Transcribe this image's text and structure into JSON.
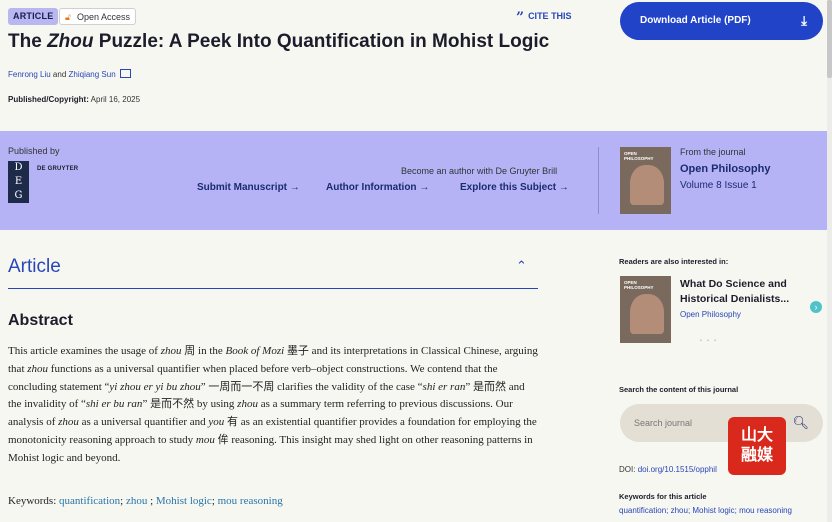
{
  "header": {
    "badge_article": "ARTICLE",
    "badge_open_access": "Open Access",
    "cite": "CITE THIS",
    "download": "Download Article (PDF)",
    "title_pre": "The ",
    "title_em": "Zhou",
    "title_post": " Puzzle: A Peek Into Quantification in Mohist Logic",
    "author1": "Fenrong Liu",
    "author_and": " and ",
    "author2": "Zhiqiang Sun",
    "pub_label": "Published/Copyright:",
    "pub_date": "April 16, 2025"
  },
  "band": {
    "published_by": "Published by",
    "publisher": "DE GRUYTER",
    "become_author": "Become an author with De Gruyter Brill",
    "links": [
      "Submit Manuscript",
      "Author Information",
      "Explore this Subject"
    ],
    "arrow": "→",
    "from_journal": "From the journal",
    "journal_name": "Open Philosophy",
    "volume": "Volume 8 Issue 1",
    "cover_title": "OPEN PHILOSOPHY"
  },
  "article": {
    "section_title": "Article",
    "abstract_heading": "Abstract",
    "abstract_parts": [
      "This article examines the usage of ",
      "zhou",
      " 周 in the ",
      "Book of Mozi",
      " 墨子 and its interpretations in Classical Chinese, arguing that ",
      "zhou",
      " functions as a universal quantifier when placed before verb–object constructions. We contend that the concluding statement “",
      "yi zhou er yi bu zhou",
      "” 一周而一不周 clarifies the validity of the case “",
      "shi er ran",
      "” 是而然 and the invalidity of “",
      "shi er bu ran",
      "” 是而不然 by using ",
      "zhou",
      " as a summary term referring to previous discussions. Our analysis of ",
      "zhou",
      " as a universal quantifier and ",
      "you",
      " 有 as an existential quantifier provides a foundation for employing the monotonicity reasoning approach to study ",
      "mou",
      " 侔 reasoning. This insight may shed light on other reasoning patterns in Mohist logic and beyond."
    ],
    "keywords_label": "Keywords:",
    "keywords": [
      "quantification",
      "zhou",
      "Mohist logic",
      "mou reasoning"
    ]
  },
  "sidebar": {
    "readers_label": "Readers are also interested in:",
    "related_title": "What Do Science and Historical Denialists...",
    "related_journal": "Open Philosophy",
    "dots": "• • •",
    "search_label": "Search the content of this journal",
    "search_placeholder": "Search journal",
    "doi_label": "DOI:",
    "doi_value": "doi.org/10.1515/opphil",
    "keywords_label": "Keywords for this article",
    "keywords": "quantification; zhou; Mohist logic; mou reasoning",
    "watermark": "山大融媒"
  },
  "colors": {
    "accent": "#2043c8",
    "band": "#b5b3f6",
    "background": "#f7f7f2",
    "link": "#2846b8"
  }
}
